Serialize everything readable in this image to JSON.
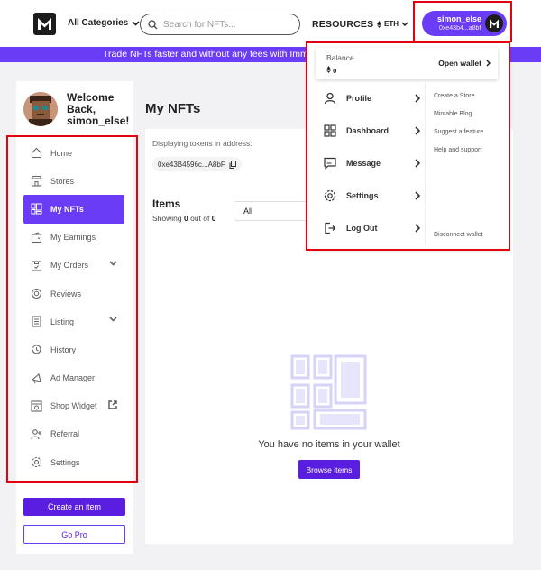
{
  "header": {
    "categories_label": "All Categories",
    "search_placeholder": "Search for NFTs...",
    "resources_label": "RESOURCES",
    "currency_label": "ETH",
    "user": {
      "name": "simon_else",
      "address": "0xe43b4...a8bf"
    }
  },
  "banner": {
    "text": "Trade NFTs faster and without any fees with Immut"
  },
  "sidebar": {
    "welcome": "Welcome Back,",
    "username": "simon_else!",
    "items": [
      {
        "label": "Home",
        "icon": "home-icon"
      },
      {
        "label": "Stores",
        "icon": "store-icon"
      },
      {
        "label": "My NFTs",
        "icon": "nft-grid-icon",
        "active": true
      },
      {
        "label": "My Earnings",
        "icon": "wallet-icon"
      },
      {
        "label": "My Orders",
        "icon": "orders-icon",
        "expandable": true
      },
      {
        "label": "Reviews",
        "icon": "reviews-icon"
      },
      {
        "label": "Listing",
        "icon": "listing-icon",
        "expandable": true
      },
      {
        "label": "History",
        "icon": "history-icon"
      },
      {
        "label": "Ad Manager",
        "icon": "megaphone-icon"
      },
      {
        "label": "Shop Widget",
        "icon": "widget-icon",
        "external": true
      },
      {
        "label": "Referral",
        "icon": "referral-icon"
      },
      {
        "label": "Settings",
        "icon": "gear-icon"
      }
    ],
    "create_button": "Create an item",
    "gopro_button": "Go Pro"
  },
  "main": {
    "title": "My NFTs",
    "displaying_label": "Displaying tokens in address:",
    "address": "0xe43B4596c...A8bF",
    "items_heading": "Items",
    "showing_prefix": "Showing",
    "showing_count": "0",
    "showing_mid": "out of",
    "showing_total": "0",
    "filter_value": "All",
    "empty_message": "You have no items in your wallet",
    "browse_button": "Browse items"
  },
  "dropdown": {
    "balance_label": "Balance",
    "balance_value": "0",
    "open_wallet": "Open wallet",
    "menu": [
      {
        "label": "Profile",
        "icon": "user-icon"
      },
      {
        "label": "Dashboard",
        "icon": "dashboard-icon"
      },
      {
        "label": "Message",
        "icon": "message-icon"
      },
      {
        "label": "Settings",
        "icon": "gear-icon"
      },
      {
        "label": "Log Out",
        "icon": "logout-icon"
      }
    ],
    "links": [
      "Create a Store",
      "Mintable Blog",
      "Suggest a feature",
      "Help and support"
    ],
    "disconnect": "Disconnect wallet"
  },
  "colors": {
    "accent": "#6b3cf6",
    "button": "#5a1ee0",
    "highlight": "#e3000f"
  }
}
